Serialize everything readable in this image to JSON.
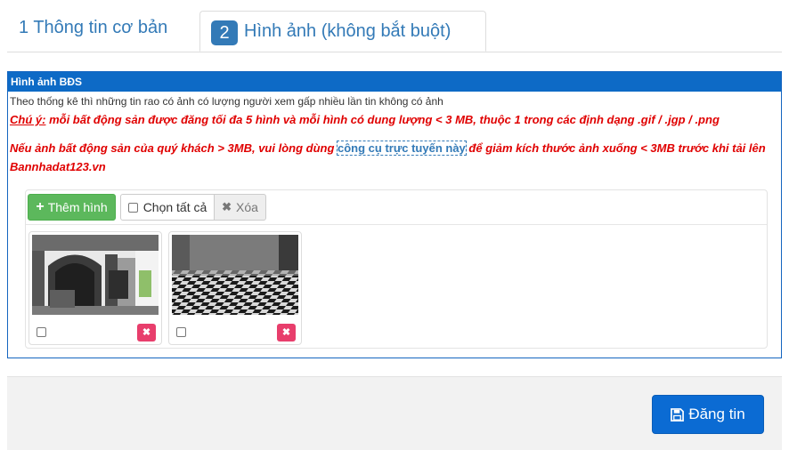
{
  "tabs": [
    {
      "label": "1 Thông tin cơ bản"
    },
    {
      "number": "2",
      "label": "Hình ảnh (không bắt buột)"
    }
  ],
  "panel": {
    "title": "Hình ảnh BĐS",
    "description": "Theo thống kê thì những tin rao có ảnh có lượng người xem gấp nhiều lần tin không có ảnh",
    "note_label": "Chú ý:",
    "note_text": " mỗi bất động sản được đăng tối đa 5 hình và mỗi hình có dung lượng < 3 MB, thuộc 1 trong các định dạng .gif / .jgp / .png",
    "warn_before": "Nếu ảnh bất động sản của quý khách > 3MB, vui lòng dùng ",
    "warn_link": "công cụ trực tuyến này",
    "warn_after": " để giảm kích thước ảnh xuống < 3MB trước khi tải lên Bannhadat123.vn"
  },
  "uploader": {
    "add_label": "Thêm hình",
    "select_all_label": "Chọn tất cả",
    "delete_label": "Xóa",
    "images": [
      {
        "alt": "Ảnh 1",
        "selected": false
      },
      {
        "alt": "Ảnh 2",
        "selected": false
      }
    ]
  },
  "footer": {
    "submit_label": "Đăng tin"
  },
  "colors": {
    "primary": "#337ab7",
    "header_blue": "#0d6ac6",
    "warning_red": "#e00000",
    "success_green": "#5cb85c",
    "remove_pink": "#e83e6c"
  },
  "icons": [
    "plus-icon",
    "checkbox-icon",
    "times-icon",
    "floppy-disk-icon"
  ]
}
